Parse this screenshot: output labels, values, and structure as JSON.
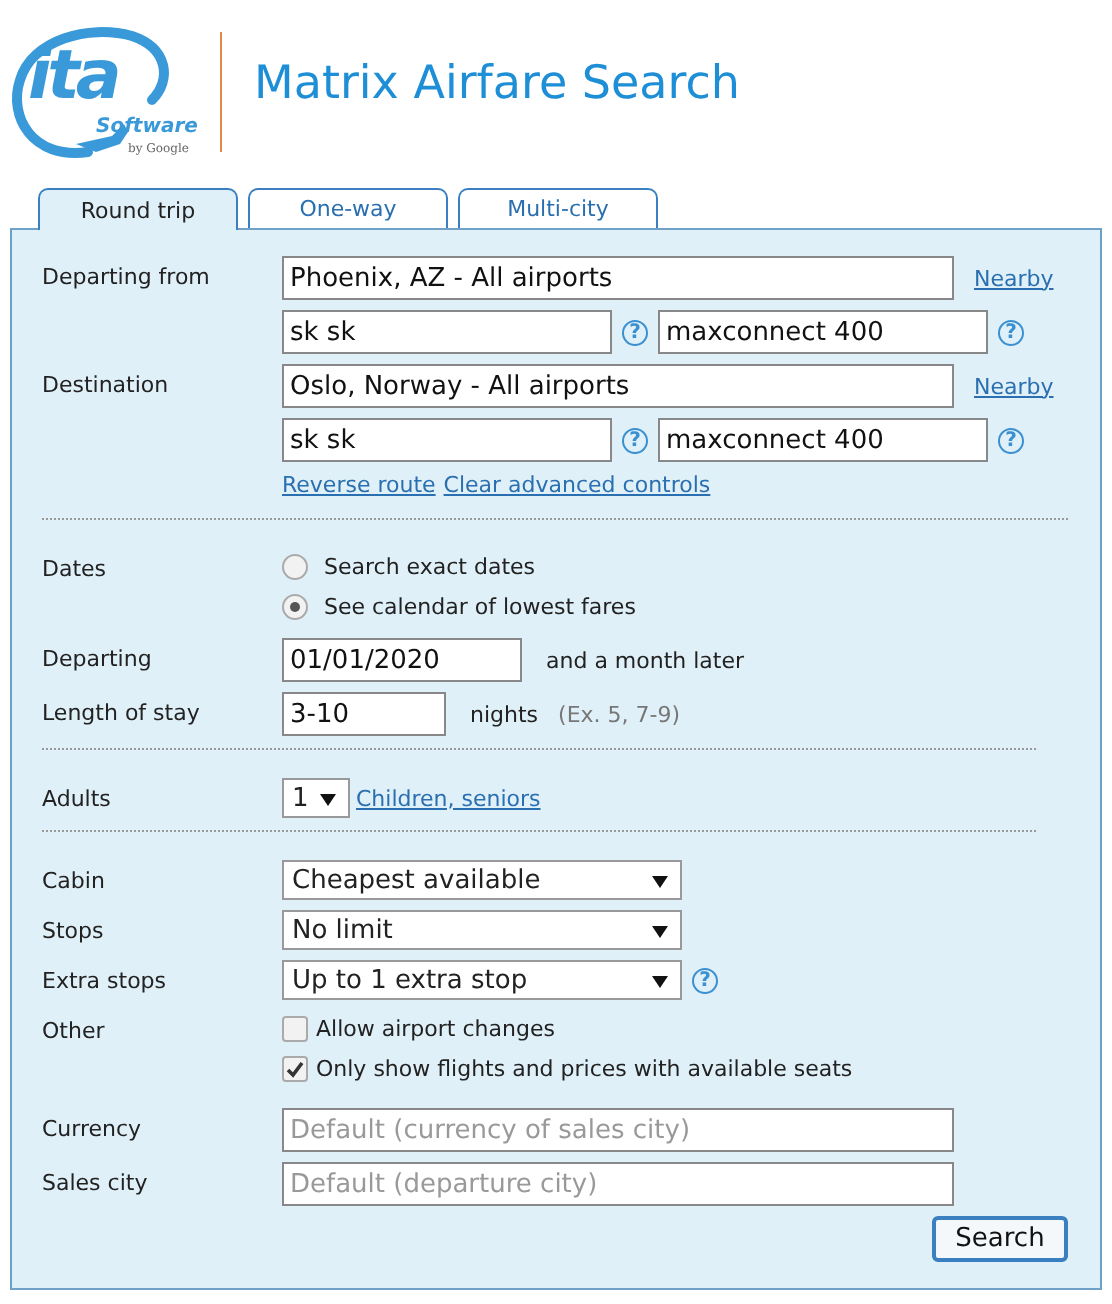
{
  "logo": {
    "mark": "ita",
    "word": "Software",
    "byline": "by Google"
  },
  "title": "Matrix Airfare Search",
  "tabs": [
    {
      "label": "Round trip",
      "selected": true
    },
    {
      "label": "One-way",
      "selected": false
    },
    {
      "label": "Multi-city",
      "selected": false
    }
  ],
  "route": [
    {
      "label": "Departing from",
      "value": "Phoenix, AZ - All airports",
      "nearby": "Nearby",
      "routing": "sk sk",
      "extension": "maxconnect 400",
      "help": "?"
    },
    {
      "label": "Destination",
      "value": "Oslo, Norway - All airports",
      "nearby": "Nearby",
      "routing": "sk sk",
      "extension": "maxconnect 400",
      "help": "?"
    }
  ],
  "route_links": [
    "Reverse route",
    "Clear advanced controls"
  ],
  "dates": {
    "label": "Dates",
    "options": [
      {
        "label": "Search exact dates",
        "selected": false
      },
      {
        "label": "See calendar of lowest fares",
        "selected": true
      }
    ],
    "departing": {
      "label": "Departing",
      "value": "01/01/2020",
      "note": "and a month later"
    },
    "stay": {
      "label": "Length of stay",
      "value": "3-10",
      "unit": "nights",
      "hint": "(Ex. 5, 7-9)"
    }
  },
  "adults": {
    "label": "Adults",
    "value": "1",
    "link": "Children, seniors"
  },
  "options": [
    {
      "kind": "select",
      "label": "Cabin",
      "value": "Cheapest available"
    },
    {
      "kind": "select",
      "label": "Stops",
      "value": "No limit"
    },
    {
      "kind": "select",
      "label": "Extra stops",
      "value": "Up to 1 extra stop",
      "help": "?"
    },
    {
      "kind": "checks",
      "label": "Other",
      "items": [
        {
          "label": "Allow airport changes",
          "checked": false
        },
        {
          "label": "Only show flights and prices with available seats",
          "checked": true
        }
      ]
    },
    {
      "kind": "text",
      "label": "Currency",
      "placeholder": "Default (currency of sales city)"
    },
    {
      "kind": "text",
      "label": "Sales city",
      "placeholder": "Default (departure city)"
    }
  ],
  "search_button": "Search"
}
